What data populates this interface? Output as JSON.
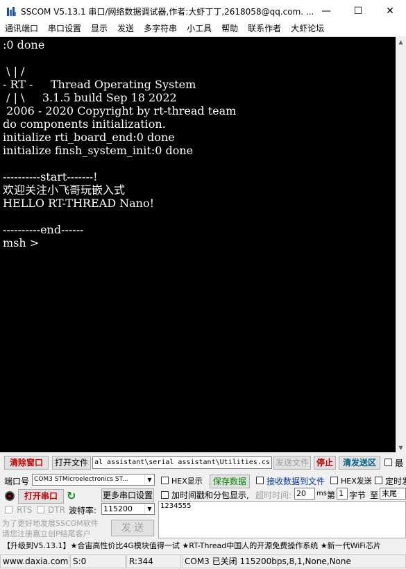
{
  "window": {
    "title": "SSCOM V5.13.1 串口/网络数据调试器,作者:大虾丁丁,2618058@qq.com. ...",
    "minimize_glyph": "—",
    "maximize_glyph": "☐",
    "close_glyph": "✕"
  },
  "menu": [
    "通讯端口",
    "串口设置",
    "显示",
    "发送",
    "多字符串",
    "小工具",
    "帮助",
    "联系作者",
    "大虾论坛"
  ],
  "terminal": {
    "lines": [
      ":0 done",
      "",
      " \\ | /",
      "- RT -     Thread Operating System",
      " / | \\     3.1.5 build Sep 18 2022",
      " 2006 - 2020 Copyright by rt-thread team",
      "do components initialization.",
      "initialize rti_board_end:0 done",
      "initialize finsh_system_init:0 done",
      "",
      "----------start-------!",
      "欢迎关注小飞哥玩嵌入式",
      "HELLO RT-THREAD Nano!",
      "",
      "----------end------",
      "msh >"
    ]
  },
  "toolbar": {
    "clear_window": "清除窗口",
    "open_file": "打开文件",
    "file_path": "al assistant\\serial assistant\\Utilities.cs",
    "send_file": "发送文件",
    "stop": "停止",
    "clear_send": "清发送区",
    "last_label": "最"
  },
  "port": {
    "port_label": "端口号",
    "port_value": "COM3 STMicroelectronics ST...",
    "hex_display": "HEX显示",
    "save_data": "保存数据",
    "receive_to_file": "接收数据到文件",
    "hex_send": "HEX发送",
    "timed_send": "定时发",
    "open_port": "打开串口",
    "more_settings": "更多串口设置",
    "timestamp": "加时间戳和分包显示,",
    "timeout_label": "超时时间:",
    "timeout_value": "20",
    "ms_label": "ms",
    "nth_label": "第",
    "nth_value": "1",
    "byte_label": "字节",
    "to_label": "至",
    "end_value": "末尾",
    "rts": "RTS",
    "dtr": "DTR",
    "baud_label": "波特率:",
    "baud_value": "115200",
    "send_text": "1234555",
    "promo_line1": "为了更好地发展SSCOM软件",
    "promo_line2": "请您注册嘉立创P结尾客户",
    "send_button": "发 送"
  },
  "ticker": "【升级到V5.13.1】★合宙高性价比4G模块值得一试 ★RT-Thread中国人的开源免费操作系统 ★新一代WiFi芯片",
  "status": {
    "site": "www.daxia.com",
    "s_count": "S:0",
    "r_count": "R:344",
    "port_state": "COM3 已关闭  115200bps,8,1,None,None"
  },
  "colors": {
    "terminal_bg": "#000000",
    "terminal_fg": "#ffffff",
    "danger_text": "#c00000",
    "ok_text": "#008000"
  }
}
